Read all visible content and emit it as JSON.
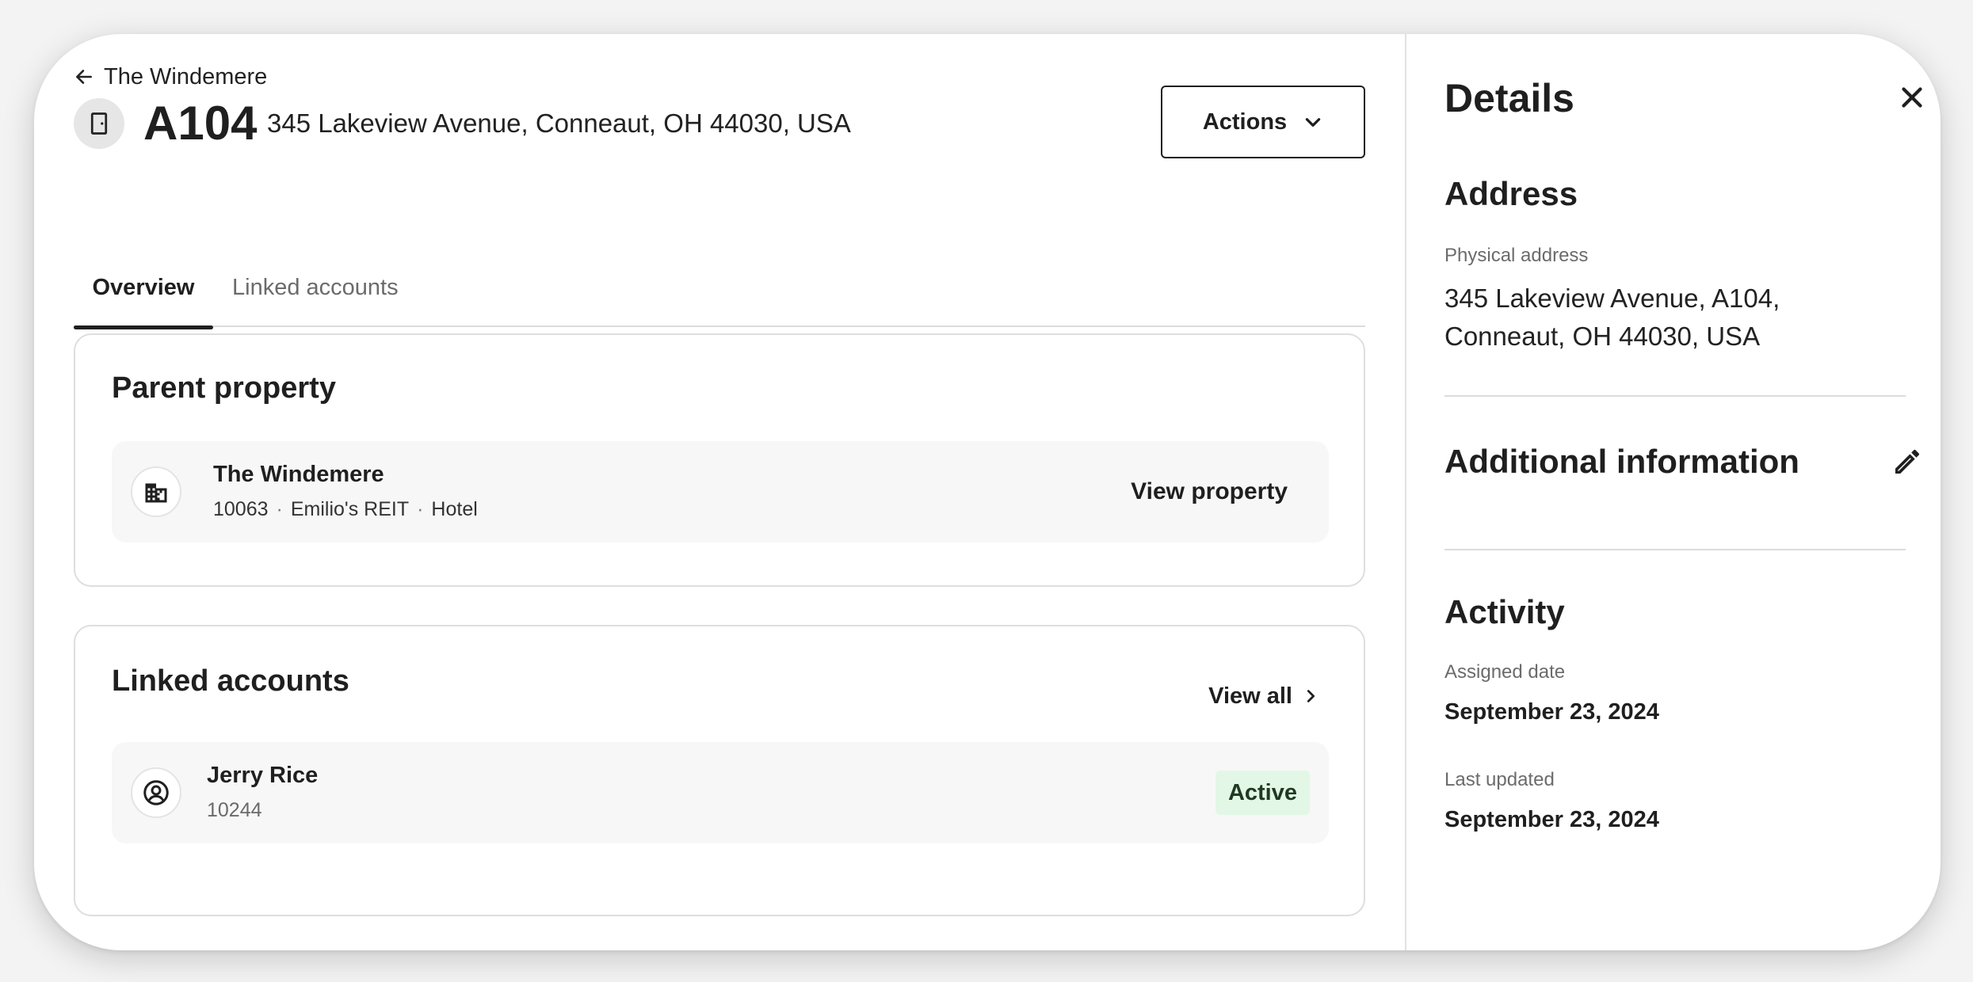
{
  "header": {
    "breadcrumb_back": "The Windemere",
    "unit": "A104",
    "address": "345 Lakeview Avenue, Conneaut, OH 44030, USA",
    "actions_label": "Actions"
  },
  "tabs": [
    {
      "label": "Overview",
      "active": true
    },
    {
      "label": "Linked accounts",
      "active": false
    }
  ],
  "parent_property": {
    "title": "Parent property",
    "name": "The Windemere",
    "id": "10063",
    "owner": "Emilio's REIT",
    "type": "Hotel",
    "separator": "·",
    "link_label": "View property"
  },
  "linked_accounts": {
    "title": "Linked accounts",
    "view_all_label": "View all",
    "items": [
      {
        "name": "Jerry Rice",
        "id": "10244",
        "status": "Active"
      }
    ]
  },
  "details": {
    "title": "Details",
    "address_section": {
      "title": "Address",
      "physical_label": "Physical address",
      "line1": "345 Lakeview Avenue, A104,",
      "line2": "Conneaut, OH 44030, USA"
    },
    "additional_section": {
      "title": "Additional information"
    },
    "activity_section": {
      "title": "Activity",
      "assigned_label": "Assigned date",
      "assigned_value": "September 23, 2024",
      "updated_label": "Last updated",
      "updated_value": "September 23, 2024"
    }
  },
  "colors": {
    "text": "#1f1f1f",
    "muted": "#6b6b6b",
    "badge_bg": "#e3f7e6",
    "row_bg": "#f7f7f7",
    "border": "#dedede"
  },
  "icons": {
    "back": "arrow-left-icon",
    "unit": "door-icon",
    "actions": "chevron-down-icon",
    "property": "building-icon",
    "account": "user-circle-icon",
    "view_all": "chevron-right-icon",
    "close": "close-icon",
    "edit": "pencil-icon"
  }
}
